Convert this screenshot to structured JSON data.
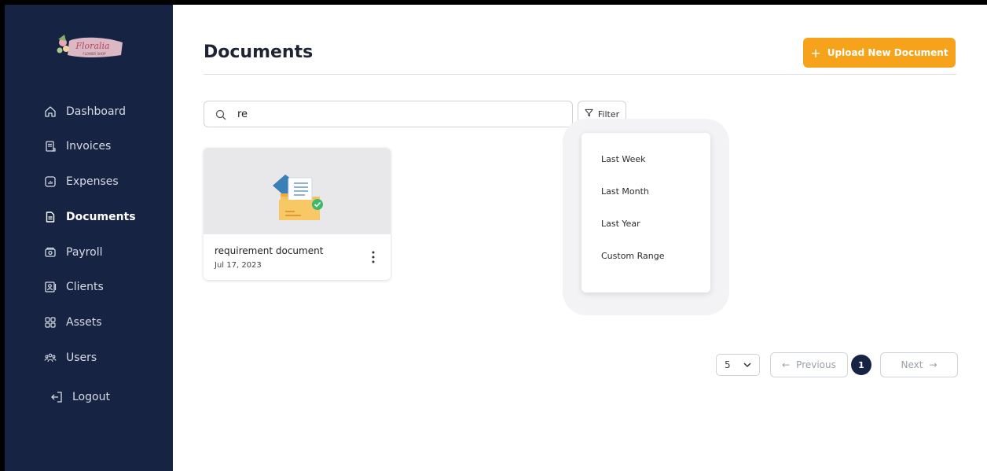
{
  "sidebar": {
    "logo_alt": "Floral Flower Shop",
    "items": [
      {
        "label": "Dashboard",
        "icon": "home-icon"
      },
      {
        "label": "Invoices",
        "icon": "invoice-icon"
      },
      {
        "label": "Expenses",
        "icon": "expenses-icon"
      },
      {
        "label": "Documents",
        "icon": "document-icon",
        "active": true
      },
      {
        "label": "Payroll",
        "icon": "payroll-icon"
      },
      {
        "label": "Clients",
        "icon": "clients-icon"
      },
      {
        "label": "Assets",
        "icon": "assets-icon"
      },
      {
        "label": "Users",
        "icon": "users-icon"
      }
    ],
    "logout": {
      "label": "Logout",
      "icon": "logout-icon"
    }
  },
  "header": {
    "title": "Documents",
    "upload_label": "Upload New Document"
  },
  "search": {
    "value": "re",
    "placeholder": ""
  },
  "filter": {
    "label": "Filter",
    "options": [
      "Last Week",
      "Last Month",
      "Last Year",
      "Custom Range"
    ]
  },
  "documents": [
    {
      "name": "requirement document",
      "date": "Jul 17, 2023"
    }
  ],
  "pagination": {
    "per_page": "5",
    "previous_label": "Previous",
    "next_label": "Next",
    "current_page": "1"
  },
  "colors": {
    "sidebar_bg": "#172343",
    "accent": "#f6a21b",
    "active_page": "#172343"
  }
}
